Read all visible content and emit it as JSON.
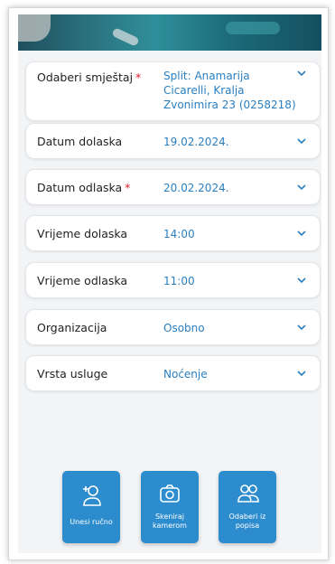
{
  "form": {
    "fields": [
      {
        "label": "Odaberi smještaj",
        "required": true,
        "value": "Split: Anamarija Cicarelli, Kralja Zvonimira 23 (0258218)"
      },
      {
        "label": "Datum dolaska",
        "required": false,
        "value": "19.02.2024."
      },
      {
        "label": "Datum odlaska",
        "required": true,
        "value": "20.02.2024."
      },
      {
        "label": "Vrijeme dolaska",
        "required": false,
        "value": "14:00"
      },
      {
        "label": "Vrijeme odlaska",
        "required": false,
        "value": "11:00"
      },
      {
        "label": "Organizacija",
        "required": false,
        "value": "Osobno"
      },
      {
        "label": "Vrsta usluge",
        "required": false,
        "value": "Noćenje"
      }
    ],
    "required_marker": "*",
    "accommodation_lines": [
      "Split: Anamarija",
      "Cicarelli, Kralja",
      "Zvonimira 23 (0258218)"
    ]
  },
  "actions": {
    "manual": {
      "label": "Unesi ručno",
      "icon": "add-person-icon"
    },
    "scan": {
      "label_line1": "Skeniraj",
      "label_line2": "kamerom",
      "icon": "camera-icon"
    },
    "list": {
      "label_line1": "Odaberi iz",
      "label_line2": "popisa",
      "icon": "people-icon"
    }
  },
  "colors": {
    "accent": "#2d8ccd",
    "value_text": "#2a7fc1",
    "required": "#e0202a"
  }
}
